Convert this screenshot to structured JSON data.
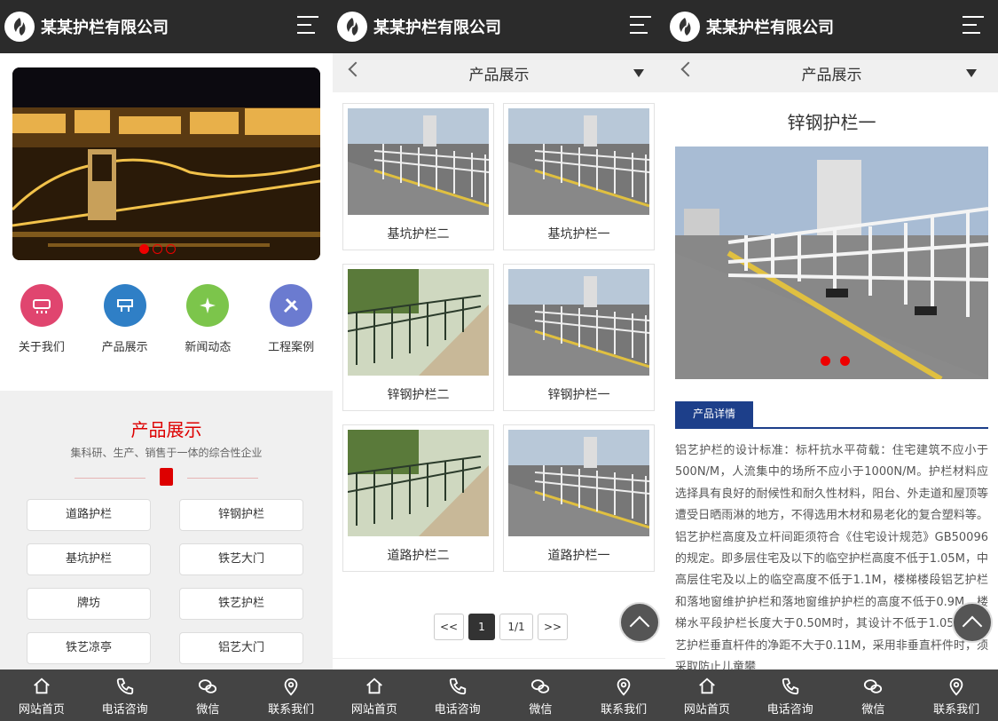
{
  "brand": "某某护栏有限公司",
  "bottom_nav": [
    "网站首页",
    "电话咨询",
    "微信",
    "联系我们"
  ],
  "home": {
    "icons": [
      {
        "label": "关于我们",
        "icon": "about-icon",
        "color": "#e0456f"
      },
      {
        "label": "产品展示",
        "icon": "product-icon",
        "color": "#2f7fc6"
      },
      {
        "label": "新闻动态",
        "icon": "news-icon",
        "color": "#7cc54b"
      },
      {
        "label": "工程案例",
        "icon": "case-icon",
        "color": "#6b7bd0"
      }
    ],
    "section_title": "产品展示",
    "section_subtitle": "集科研、生产、销售于一体的综合性企业",
    "categories": [
      "道路护栏",
      "锌钢护栏",
      "基坑护栏",
      "铁艺大门",
      "牌坊",
      "铁艺护栏",
      "铁艺凉亭",
      "铝艺大门"
    ]
  },
  "list": {
    "title": "产品展示",
    "products": [
      "基坑护栏二",
      "基坑护栏一",
      "锌钢护栏二",
      "锌钢护栏一",
      "道路护栏二",
      "道路护栏一"
    ],
    "pager": {
      "first": "<<",
      "current": "1",
      "total": "1/1",
      "next": ">>"
    }
  },
  "detail": {
    "title": "产品展示",
    "product_title": "锌钢护栏一",
    "tab": "产品详情",
    "text": "铝艺护栏的设计标准：标杆抗水平荷载：住宅建筑不应小于500N/M，人流集中的场所不应小于1000N/M。护栏材料应选择具有良好的耐候性和耐久性材料，阳台、外走道和屋顶等遭受日晒雨淋的地方，不得选用木材和易老化的复合塑料等。铝艺护栏高度及立杆间距须符合《住宅设计规范》GB50096的规定。即多层住宅及以下的临空护栏高度不低于1.05M，中高层住宅及以上的临空高度不低于1.1M，楼梯楼段铝艺护栏和落地窗维护护栏和落地窗维护护栏的高度不低于0.9M，楼梯水平段护栏长度大于0.50M时，其设计不低于1.05M。铝艺护栏垂直杆件的净距不大于0.11M，采用非垂直杆件时，须采取防止儿童攀"
  },
  "colors": {
    "header": "#2b2b2b",
    "accent": "#dd0000",
    "tab": "#1d3f8a",
    "bottom": "#444444"
  }
}
